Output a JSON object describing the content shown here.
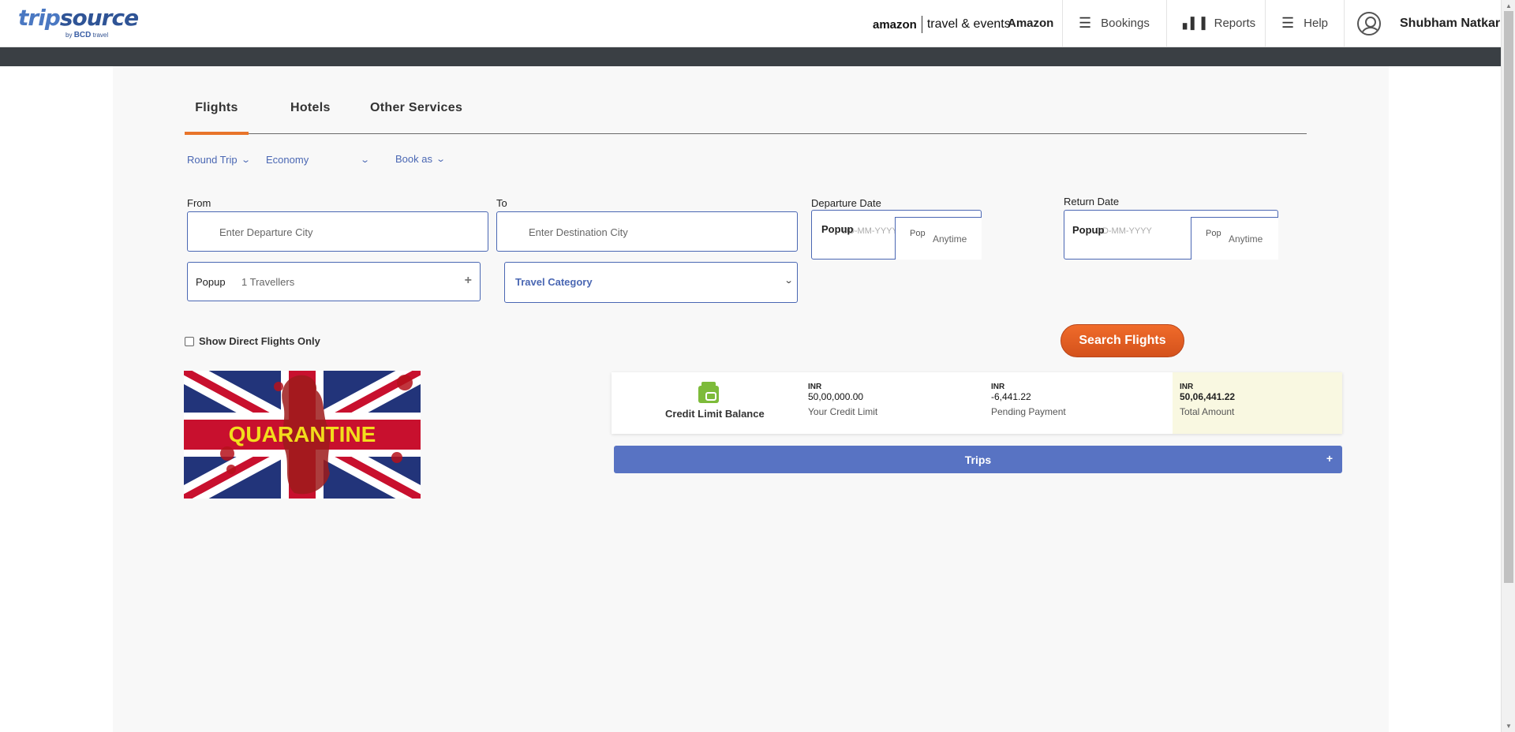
{
  "header": {
    "logo_main_a": "trip",
    "logo_main_b": "source",
    "logo_sub_by": "by",
    "logo_sub_brand": "BCD",
    "logo_sub_travel": "travel",
    "brand_amazon": "amazon",
    "brand_te": "travel & events",
    "company": "Amazon",
    "nav": {
      "bookings": "Bookings",
      "reports": "Reports",
      "help": "Help"
    },
    "user_name": "Shubham Natkar"
  },
  "tabs": [
    "Flights",
    "Hotels",
    "Other Services"
  ],
  "options": {
    "trip_type": "Round Trip",
    "cabin": "Economy",
    "book_as": "Book as"
  },
  "form": {
    "from_label": "From",
    "from_placeholder": "Enter Departure City",
    "to_label": "To",
    "to_placeholder": "Enter Destination City",
    "departure_label": "Departure Date",
    "return_label": "Return Date",
    "date_placeholder": "DD-MM-YYYY",
    "popup_alt": "Popup",
    "popup_alt_short": "Pop",
    "anytime": "Anytime",
    "travellers": "1 Travellers",
    "travel_category": "Travel Category",
    "direct_flights": "Show Direct Flights Only",
    "search_button": "Search Flights"
  },
  "banner": {
    "text": "QUARANTINE"
  },
  "credit": {
    "title": "Credit Limit Balance",
    "currency": "INR",
    "credit_limit": "50,00,000.00",
    "credit_limit_label": "Your Credit Limit",
    "pending": "-6,441.22",
    "pending_label": "Pending Payment",
    "total": "50,06,441.22",
    "total_label": "Total Amount"
  },
  "trips": {
    "label": "Trips",
    "toggle": "+"
  },
  "colors": {
    "accent": "#e8742a",
    "primary": "#4a67b3",
    "trips_bar": "#5873c3",
    "wallet": "#7dbb3a"
  }
}
